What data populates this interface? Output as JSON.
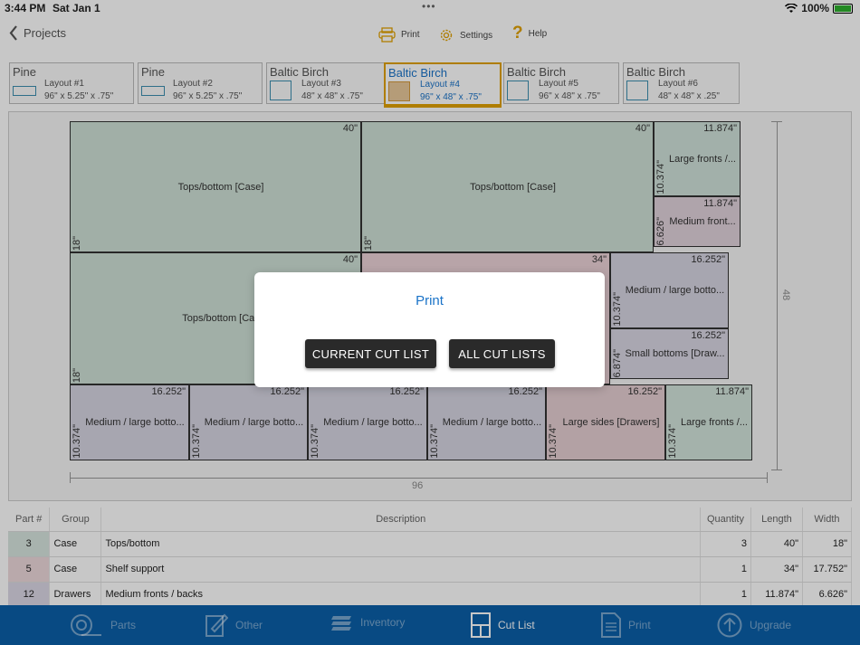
{
  "status": {
    "time": "3:44 PM",
    "date": "Sat Jan 1",
    "battery": "100%",
    "battery_icon": "battery-icon",
    "wifi_icon": "wifi-icon"
  },
  "nav": {
    "back_label": "Projects",
    "print_label": "Print",
    "settings_label": "Settings",
    "help_label": "Help"
  },
  "layouts": [
    {
      "material": "Pine",
      "name": "Layout #1",
      "dims": "96\" x 5.25\" x .75\""
    },
    {
      "material": "Pine",
      "name": "Layout #2",
      "dims": "96\" x 5.25\" x .75\""
    },
    {
      "material": "Baltic Birch",
      "name": "Layout #3",
      "dims": "48\" x 48\" x .75\""
    },
    {
      "material": "Baltic Birch",
      "name": "Layout #4",
      "dims": "96\" x 48\" x .75\""
    },
    {
      "material": "Baltic Birch",
      "name": "Layout #5",
      "dims": "96\" x 48\" x .75\""
    },
    {
      "material": "Baltic Birch",
      "name": "Layout #6",
      "dims": "48\" x 48\" x .25\""
    }
  ],
  "sheet": {
    "width_label": "96",
    "height_label": "48"
  },
  "pieces": [
    {
      "label": "Tops/bottom [Case]",
      "w": "40\"",
      "h": "18\""
    },
    {
      "label": "Tops/bottom [Case]",
      "w": "40\"",
      "h": "18\""
    },
    {
      "label": "Large fronts /...",
      "w": "11.874\"",
      "h": "10.374\""
    },
    {
      "label": "Medium front...",
      "w": "11.874\"",
      "h": "6.626\""
    },
    {
      "label": "Tops/bottom [Cas",
      "w": "40\"",
      "h": "18\""
    },
    {
      "label": "",
      "w": "34\"",
      "h": ""
    },
    {
      "label": "Medium / large botto...",
      "w": "16.252\"",
      "h": "10.374\""
    },
    {
      "label": "Small bottoms [Draw...",
      "w": "16.252\"",
      "h": "6.874\""
    },
    {
      "label": "Medium / large botto...",
      "w": "16.252\"",
      "h": "10.374\""
    },
    {
      "label": "Medium / large botto...",
      "w": "16.252\"",
      "h": "10.374\""
    },
    {
      "label": "Medium / large botto...",
      "w": "16.252\"",
      "h": "10.374\""
    },
    {
      "label": "Medium / large botto...",
      "w": "16.252\"",
      "h": "10.374\""
    },
    {
      "label": "Large sides [Drawers]",
      "w": "16.252\"",
      "h": "10.374\""
    },
    {
      "label": "Large fronts /...",
      "w": "11.874\"",
      "h": "10.374\""
    }
  ],
  "modal": {
    "title": "Print",
    "current_btn": "CURRENT CUT LIST",
    "all_btn": "ALL CUT LISTS"
  },
  "table": {
    "headers": [
      "Part #",
      "Group",
      "Description",
      "Quantity",
      "Length",
      "Width"
    ],
    "rows": [
      [
        "3",
        "Case",
        "Tops/bottom",
        "3",
        "40\"",
        "18\""
      ],
      [
        "5",
        "Case",
        "Shelf support",
        "1",
        "34\"",
        "17.752\""
      ],
      [
        "12",
        "Drawers",
        "Medium fronts / backs",
        "1",
        "11.874\"",
        "6.626\""
      ]
    ]
  },
  "bottom_nav": [
    "Parts",
    "Other",
    "Inventory",
    "Cut List",
    "Print",
    "Upgrade"
  ],
  "colors": {
    "accent": "#1a73c8",
    "bar": "#0b5fa8",
    "active_tab": "#e0a100"
  }
}
